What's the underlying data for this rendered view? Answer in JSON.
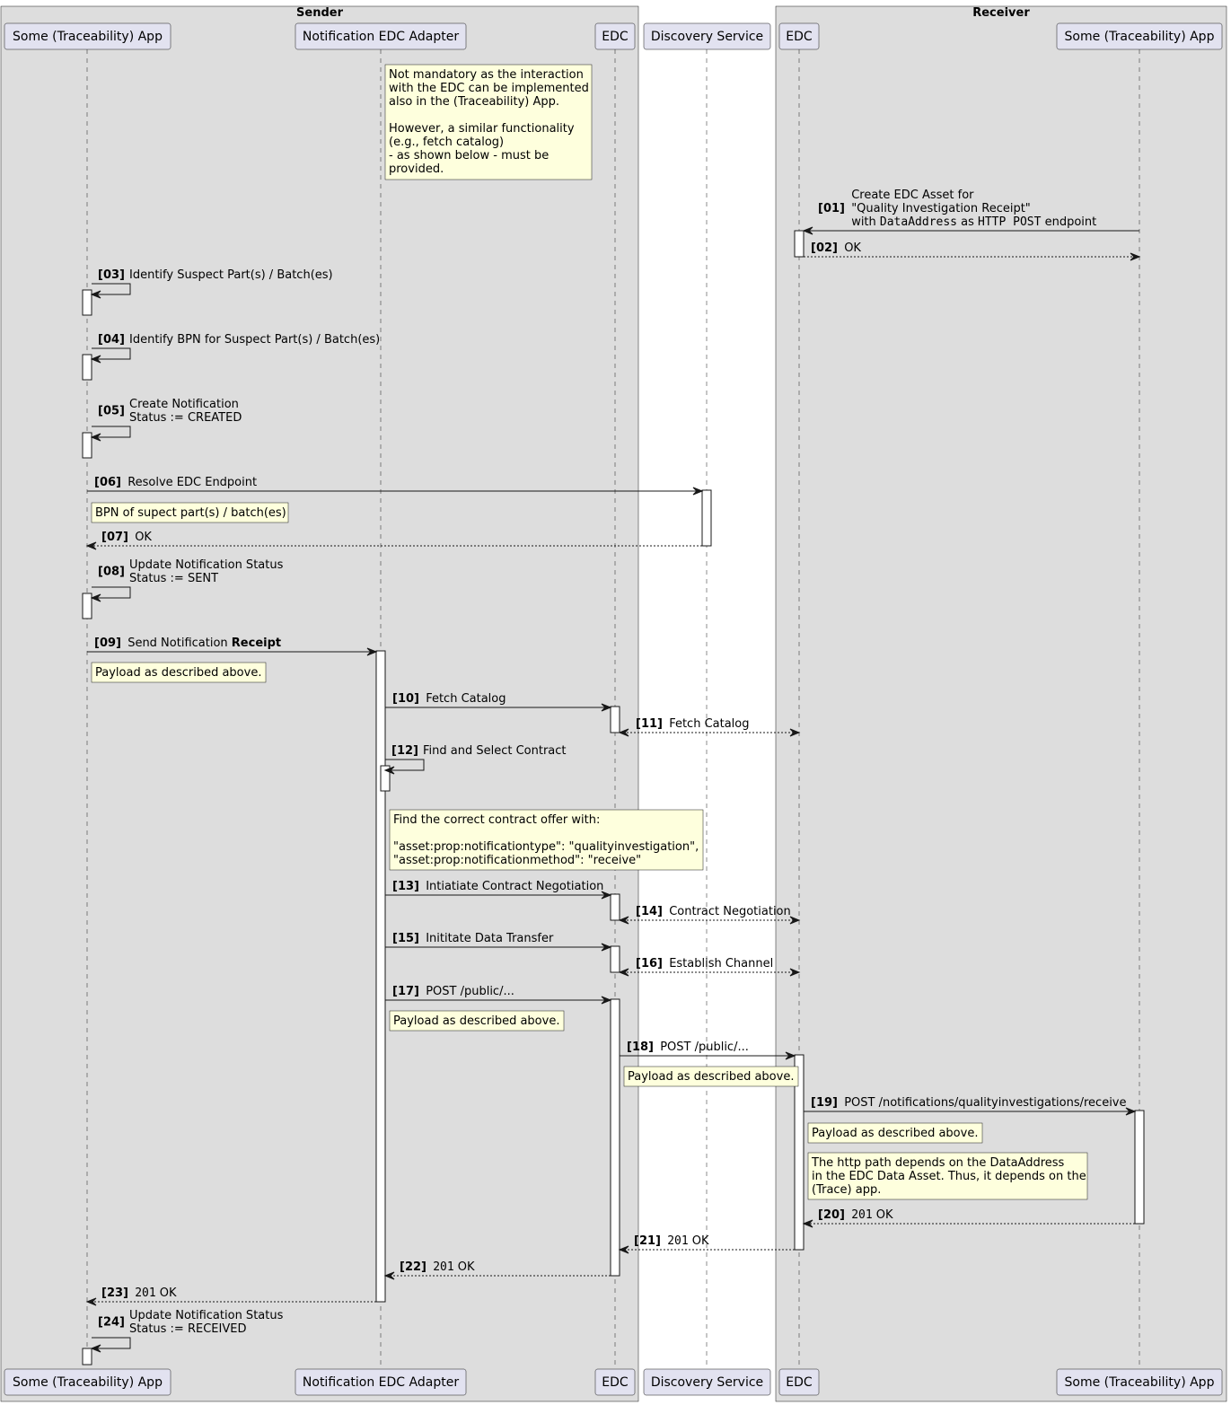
{
  "colors": {
    "group_fill": "#DDDDDD",
    "participant_fill": "#E2E2F0",
    "note_fill": "#FEFFDD",
    "activation_fill": "#FFFFFF",
    "line": "#181818"
  },
  "boxes": [
    {
      "id": "sender",
      "title": "Sender"
    },
    {
      "id": "receiver",
      "title": "Receiver"
    }
  ],
  "participants": [
    {
      "id": "s_app",
      "label": "Some (Traceability) App",
      "box": "sender"
    },
    {
      "id": "s_adapter",
      "label": "Notification EDC Adapter",
      "box": "sender"
    },
    {
      "id": "s_edc",
      "label": "EDC",
      "box": "sender"
    },
    {
      "id": "discovery",
      "label": "Discovery Service",
      "box": null
    },
    {
      "id": "r_edc",
      "label": "EDC",
      "box": "receiver"
    },
    {
      "id": "r_app",
      "label": "Some (Traceability) App",
      "box": "receiver"
    }
  ],
  "notes": [
    {
      "id": "note-not-mandatory",
      "over": "s_adapter",
      "lines": [
        "Not mandatory as the interaction",
        "with the EDC can be implemented",
        "also in the (Traceability) App.",
        "",
        "However, a similar functionality",
        "(e.g., fetch catalog)",
        "- as shown below - must be",
        "provided."
      ]
    },
    {
      "id": "note-bpn",
      "over": "s_app",
      "lines": [
        "BPN of supect part(s) / batch(es)"
      ]
    },
    {
      "id": "note-payload-1",
      "over": "s_app",
      "lines": [
        "Payload as described above."
      ]
    },
    {
      "id": "note-contract-offer",
      "over": "s_adapter",
      "lines": [
        "Find the correct contract offer with:",
        "",
        "\"asset:prop:notificationtype\": \"qualityinvestigation\",",
        "\"asset:prop:notificationmethod\": \"receive\""
      ]
    },
    {
      "id": "note-payload-2",
      "over": "s_adapter",
      "lines": [
        "Payload as described above."
      ]
    },
    {
      "id": "note-payload-3",
      "over": "s_edc",
      "lines": [
        "Payload as described above."
      ]
    },
    {
      "id": "note-payload-4",
      "over": "r_edc",
      "lines": [
        "Payload as described above."
      ]
    },
    {
      "id": "note-http-path",
      "over": "r_edc",
      "lines": [
        "The http path depends on the DataAddress",
        "in the EDC Data Asset. Thus, it depends on the",
        "(Trace) app."
      ]
    }
  ],
  "messages": [
    {
      "num": "[01]",
      "from": "r_app",
      "to": "r_edc",
      "style": "solid",
      "label": [
        [
          {
            "t": "Create EDC Asset for"
          }
        ],
        [
          {
            "t": "\"Quality Investigation Receipt\""
          }
        ],
        [
          {
            "t": "with "
          },
          {
            "t": "DataAddress",
            "mono": true
          },
          {
            "t": " as "
          },
          {
            "t": "HTTP POST",
            "mono": true
          },
          {
            "t": " endpoint"
          }
        ]
      ]
    },
    {
      "num": "[02]",
      "from": "r_edc",
      "to": "r_app",
      "style": "dashed",
      "label": [
        [
          {
            "t": "OK"
          }
        ]
      ]
    },
    {
      "num": "[03]",
      "from": "s_app",
      "to": "s_app",
      "style": "self",
      "label": [
        [
          {
            "t": "Identify Suspect Part(s) / Batch(es)"
          }
        ]
      ]
    },
    {
      "num": "[04]",
      "from": "s_app",
      "to": "s_app",
      "style": "self",
      "label": [
        [
          {
            "t": "Identify BPN for Suspect Part(s) / Batch(es)"
          }
        ]
      ]
    },
    {
      "num": "[05]",
      "from": "s_app",
      "to": "s_app",
      "style": "self",
      "label": [
        [
          {
            "t": "Create Notification"
          }
        ],
        [
          {
            "t": "Status := CREATED"
          }
        ]
      ]
    },
    {
      "num": "[06]",
      "from": "s_app",
      "to": "discovery",
      "style": "solid",
      "label": [
        [
          {
            "t": "Resolve EDC Endpoint"
          }
        ]
      ]
    },
    {
      "num": "[07]",
      "from": "discovery",
      "to": "s_app",
      "style": "dashed",
      "label": [
        [
          {
            "t": "OK"
          }
        ]
      ]
    },
    {
      "num": "[08]",
      "from": "s_app",
      "to": "s_app",
      "style": "self",
      "label": [
        [
          {
            "t": "Update Notification Status"
          }
        ],
        [
          {
            "t": "Status := SENT"
          }
        ]
      ]
    },
    {
      "num": "[09]",
      "from": "s_app",
      "to": "s_adapter",
      "style": "solid",
      "label": [
        [
          {
            "t": "Send Notification "
          },
          {
            "t": "Receipt",
            "bold": true
          }
        ]
      ]
    },
    {
      "num": "[10]",
      "from": "s_adapter",
      "to": "s_edc",
      "style": "solid",
      "label": [
        [
          {
            "t": "Fetch Catalog"
          }
        ]
      ]
    },
    {
      "num": "[11]",
      "from": "s_edc",
      "to": "r_edc",
      "style": "bidashed",
      "label": [
        [
          {
            "t": "Fetch Catalog"
          }
        ]
      ]
    },
    {
      "num": "[12]",
      "from": "s_adapter",
      "to": "s_adapter",
      "style": "self",
      "label": [
        [
          {
            "t": "Find and Select Contract"
          }
        ]
      ]
    },
    {
      "num": "[13]",
      "from": "s_adapter",
      "to": "s_edc",
      "style": "solid",
      "label": [
        [
          {
            "t": "Intiatiate Contract Negotiation"
          }
        ]
      ]
    },
    {
      "num": "[14]",
      "from": "s_edc",
      "to": "r_edc",
      "style": "bidashed",
      "label": [
        [
          {
            "t": "Contract Negotiation"
          }
        ]
      ]
    },
    {
      "num": "[15]",
      "from": "s_adapter",
      "to": "s_edc",
      "style": "solid",
      "label": [
        [
          {
            "t": "Inititate Data Transfer"
          }
        ]
      ]
    },
    {
      "num": "[16]",
      "from": "s_edc",
      "to": "r_edc",
      "style": "bidashed",
      "label": [
        [
          {
            "t": "Establish Channel"
          }
        ]
      ]
    },
    {
      "num": "[17]",
      "from": "s_adapter",
      "to": "s_edc",
      "style": "solid",
      "label": [
        [
          {
            "t": "POST /public/..."
          }
        ]
      ]
    },
    {
      "num": "[18]",
      "from": "s_edc",
      "to": "r_edc",
      "style": "solid",
      "label": [
        [
          {
            "t": "POST /public/..."
          }
        ]
      ]
    },
    {
      "num": "[19]",
      "from": "r_edc",
      "to": "r_app",
      "style": "solid",
      "label": [
        [
          {
            "t": "POST /notifications/qualityinvestigations/receive"
          }
        ]
      ]
    },
    {
      "num": "[20]",
      "from": "r_app",
      "to": "r_edc",
      "style": "dashed",
      "label": [
        [
          {
            "t": "201",
            "mono": true
          },
          {
            "t": " OK"
          }
        ]
      ]
    },
    {
      "num": "[21]",
      "from": "r_edc",
      "to": "s_edc",
      "style": "dashed",
      "label": [
        [
          {
            "t": "201",
            "mono": true
          },
          {
            "t": " OK"
          }
        ]
      ]
    },
    {
      "num": "[22]",
      "from": "s_edc",
      "to": "s_adapter",
      "style": "dashed",
      "label": [
        [
          {
            "t": "201",
            "mono": true
          },
          {
            "t": " OK"
          }
        ]
      ]
    },
    {
      "num": "[23]",
      "from": "s_adapter",
      "to": "s_app",
      "style": "dashed",
      "label": [
        [
          {
            "t": "201",
            "mono": true
          },
          {
            "t": " OK"
          }
        ]
      ]
    },
    {
      "num": "[24]",
      "from": "s_app",
      "to": "s_app",
      "style": "self",
      "label": [
        [
          {
            "t": "Update Notification Status"
          }
        ],
        [
          {
            "t": "Status := RECEIVED"
          }
        ]
      ]
    }
  ]
}
